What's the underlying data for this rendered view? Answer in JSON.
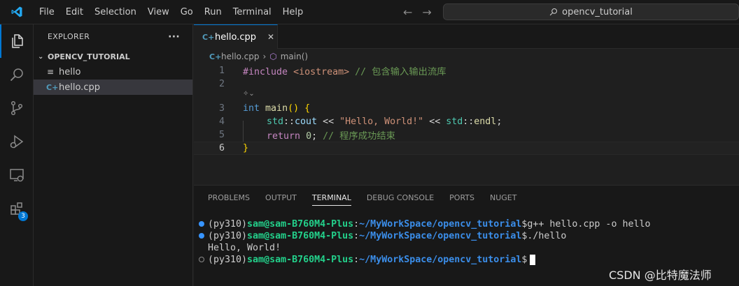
{
  "menu": [
    "File",
    "Edit",
    "Selection",
    "View",
    "Go",
    "Run",
    "Terminal",
    "Help"
  ],
  "search": {
    "text": "opencv_tutorial"
  },
  "activity": {
    "extensions_badge": "3"
  },
  "sidebar": {
    "title": "EXPLORER",
    "more": "···",
    "folder": "OPENCV_TUTORIAL",
    "files": [
      {
        "name": "hello",
        "icon": "text-file-icon"
      },
      {
        "name": "hello.cpp",
        "icon": "cpp-file-icon",
        "selected": true
      }
    ]
  },
  "tab": {
    "label": "hello.cpp",
    "close": "✕"
  },
  "breadcrumb": {
    "file": "hello.cpp",
    "symbol": "main()"
  },
  "editor": {
    "line_numbers": [
      "1",
      "2",
      "3",
      "4",
      "5",
      "6"
    ],
    "line1": {
      "pp": "#include",
      "inc": "<iostream>",
      "cm": "// 包含输入输出流库"
    },
    "line3": {
      "kw": "int",
      "fn": "main",
      "paren": "()",
      "brace": "{"
    },
    "line4": {
      "ns1": "std",
      "sep1": "::",
      "id1": "cout",
      "op1": " << ",
      "str": "\"Hello, World!\"",
      "op2": " << ",
      "ns2": "std",
      "sep2": "::",
      "id2": "endl",
      "semi": ";"
    },
    "line5": {
      "kw": "return",
      "num": "0",
      "semi": ";",
      "cm": "// 程序成功结束"
    },
    "line6": {
      "brace": "}"
    }
  },
  "panel": {
    "tabs": [
      "PROBLEMS",
      "OUTPUT",
      "TERMINAL",
      "DEBUG CONSOLE",
      "PORTS",
      "NUGET"
    ],
    "active_tab": "TERMINAL"
  },
  "terminal": {
    "env": "(py310)",
    "user": "sam@sam-B760M4-Plus",
    "colon": ":",
    "path": "~/MyWorkSpace/opencv_tutorial",
    "prompt": "$",
    "cmd1": "g++ hello.cpp -o hello",
    "cmd2": "./hello",
    "output": "Hello, World!"
  },
  "watermark": "CSDN @比特魔法师"
}
